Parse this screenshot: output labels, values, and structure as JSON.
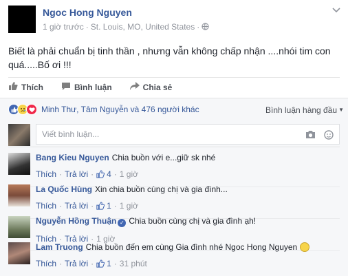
{
  "post": {
    "author": "Ngoc Hong Nguyen",
    "time": "1 giờ trước",
    "location": "St. Louis, MO, United States",
    "text": "Biết là phải chuẩn bị tinh thần , nhưng vẫn không chấp nhận ....nhói tim con quá.....Bố ơi !!!"
  },
  "actions": {
    "like": "Thích",
    "comment": "Bình luận",
    "share": "Chia sẻ"
  },
  "summary": {
    "reactors": "Minh Thư, Tâm Nguyễn và 476 người khác",
    "sort_label": "Bình luận hàng đầu"
  },
  "composer": {
    "placeholder": "Viết bình luận..."
  },
  "comment_actions": {
    "like": "Thích",
    "reply": "Trả lời"
  },
  "comments": [
    {
      "name": "Bang Kieu Nguyen",
      "text": "Chia buồn với e...giữ sk nhé",
      "likes": "4",
      "time": "1 giờ"
    },
    {
      "name": "La Quốc Hùng",
      "text": "Xin chia buồn cùng chị và gia đình...",
      "likes": "1",
      "time": "1 giờ"
    },
    {
      "name": "Nguyễn Hồng Thuận",
      "text": "Chia buồn cùng chị và gia đình ạh!",
      "likes": "",
      "time": "1 giờ"
    },
    {
      "name": "Lam Truong",
      "text": "Chia buồn đến em cùng Gia đình nhé Ngoc Hong Nguyen",
      "likes": "1",
      "time": "31 phút"
    }
  ],
  "colors": {
    "link_blue": "#365899",
    "meta_gray": "#90949c",
    "background": "#f6f7f9"
  },
  "icons": {
    "globe": "globe-icon",
    "like": "thumbs-up-icon",
    "comment": "speech-bubble-icon",
    "share": "share-arrow-icon",
    "camera": "camera-icon",
    "sticker": "sticker-smile-icon",
    "menu": "chevron-down-icon",
    "verified": "verified-check-icon"
  }
}
